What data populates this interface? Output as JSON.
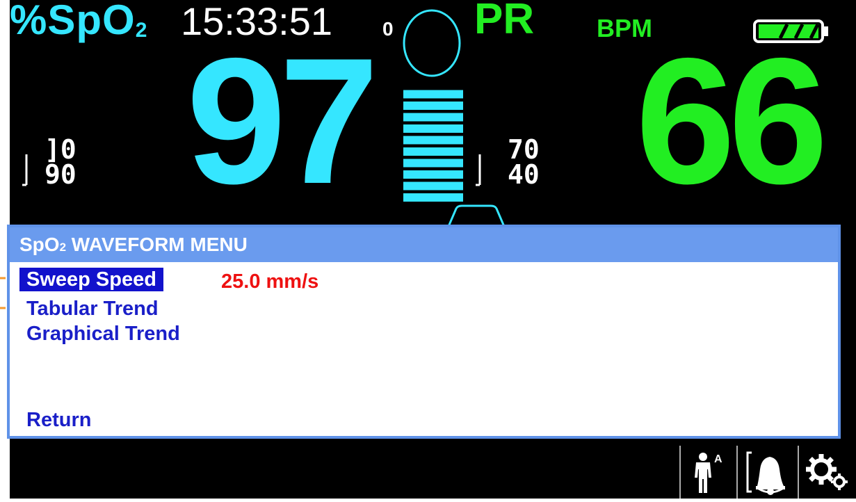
{
  "vitals": {
    "spo2_label": "%SpO",
    "spo2_label_sub": "2",
    "time": "15:33:51",
    "pulse_zero": "0",
    "pr_label": "PR",
    "bpm_label": "BPM",
    "spo2_value": "97",
    "pr_value": "66",
    "spo2_limit_high": "]0",
    "spo2_limit_low": "90",
    "pr_limit_high": "70",
    "pr_limit_low": "40",
    "signal_bars_lit": 10,
    "signal_bars_total": 10,
    "battery_level": 1.0
  },
  "menu": {
    "title": "SpO",
    "title_sub": "2",
    "title_rest": " WAVEFORM MENU",
    "items": [
      {
        "label": "Sweep Speed",
        "selected": true
      },
      {
        "label": "Tabular Trend",
        "selected": false
      },
      {
        "label": "Graphical Trend",
        "selected": false
      },
      {
        "label": "Return",
        "selected": false
      }
    ],
    "sweep_speed_value": "25.0 mm/s"
  },
  "softkeys": {
    "patient_mode_letter": "A",
    "icons": [
      "patient-adult-icon",
      "alarm-bell-icon",
      "settings-gears-icon"
    ]
  },
  "colors": {
    "spo2": "#35e6ff",
    "pr": "#22ee22",
    "menu_header": "#6a9bee",
    "menu_text": "#1a1fc8",
    "selected_bg": "#1212cc",
    "value_red": "#ee1111",
    "marker": "#f59a2e"
  }
}
